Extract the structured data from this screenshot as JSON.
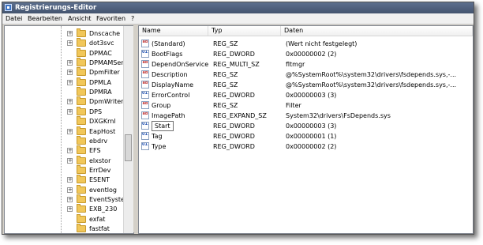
{
  "window": {
    "title": "Registrierungs-Editor"
  },
  "menu": [
    "Datei",
    "Bearbeiten",
    "Ansicht",
    "Favoriten",
    "?"
  ],
  "tree": {
    "items": [
      {
        "label": "Dnscache",
        "expander": "+"
      },
      {
        "label": "dot3svc",
        "expander": "+"
      },
      {
        "label": "DPMAC",
        "expander": ""
      },
      {
        "label": "DPMAMServ",
        "expander": "+"
      },
      {
        "label": "DpmFilter",
        "expander": "+"
      },
      {
        "label": "DPMLA",
        "expander": "+"
      },
      {
        "label": "DPMRA",
        "expander": ""
      },
      {
        "label": "DpmWriter",
        "expander": "+"
      },
      {
        "label": "DPS",
        "expander": "+"
      },
      {
        "label": "DXGKrnl",
        "expander": ""
      },
      {
        "label": "EapHost",
        "expander": "+"
      },
      {
        "label": "ebdrv",
        "expander": ""
      },
      {
        "label": "EFS",
        "expander": "+"
      },
      {
        "label": "elxstor",
        "expander": "+"
      },
      {
        "label": "ErrDev",
        "expander": ""
      },
      {
        "label": "ESENT",
        "expander": "+"
      },
      {
        "label": "eventlog",
        "expander": "+"
      },
      {
        "label": "EventSyster",
        "expander": "+"
      },
      {
        "label": "EXB_230",
        "expander": "+"
      },
      {
        "label": "exfat",
        "expander": ""
      },
      {
        "label": "fastfat",
        "expander": ""
      }
    ]
  },
  "list": {
    "columns": {
      "name": "Name",
      "type": "Typ",
      "data": "Daten"
    },
    "rows": [
      {
        "icon": "ab",
        "kind": "sz",
        "name": "(Standard)",
        "type": "REG_SZ",
        "data": "(Wert nicht festgelegt)"
      },
      {
        "icon": "011",
        "kind": "bin",
        "name": "BootFlags",
        "type": "REG_DWORD",
        "data": "0x00000002 (2)"
      },
      {
        "icon": "ab",
        "kind": "sz",
        "name": "DependOnService",
        "type": "REG_MULTI_SZ",
        "data": "fltmgr"
      },
      {
        "icon": "ab",
        "kind": "sz",
        "name": "Description",
        "type": "REG_SZ",
        "data": "@%SystemRoot%\\system32\\drivers\\fsdepends.sys,-..."
      },
      {
        "icon": "ab",
        "kind": "sz",
        "name": "DisplayName",
        "type": "REG_SZ",
        "data": "@%SystemRoot%\\system32\\drivers\\fsdepends.sys,-..."
      },
      {
        "icon": "011",
        "kind": "bin",
        "name": "ErrorControl",
        "type": "REG_DWORD",
        "data": "0x00000003 (3)"
      },
      {
        "icon": "ab",
        "kind": "sz",
        "name": "Group",
        "type": "REG_SZ",
        "data": "Filter"
      },
      {
        "icon": "ab",
        "kind": "sz",
        "name": "ImagePath",
        "type": "REG_EXPAND_SZ",
        "data": "System32\\drivers\\FsDepends.sys"
      },
      {
        "icon": "011",
        "kind": "bin",
        "name": "Start",
        "type": "REG_DWORD",
        "data": "0x00000003 (3)"
      },
      {
        "icon": "011",
        "kind": "bin",
        "name": "Tag",
        "type": "REG_DWORD",
        "data": "0x00000001 (1)"
      },
      {
        "icon": "011",
        "kind": "bin",
        "name": "Type",
        "type": "REG_DWORD",
        "data": "0x00000002 (2)"
      }
    ]
  }
}
